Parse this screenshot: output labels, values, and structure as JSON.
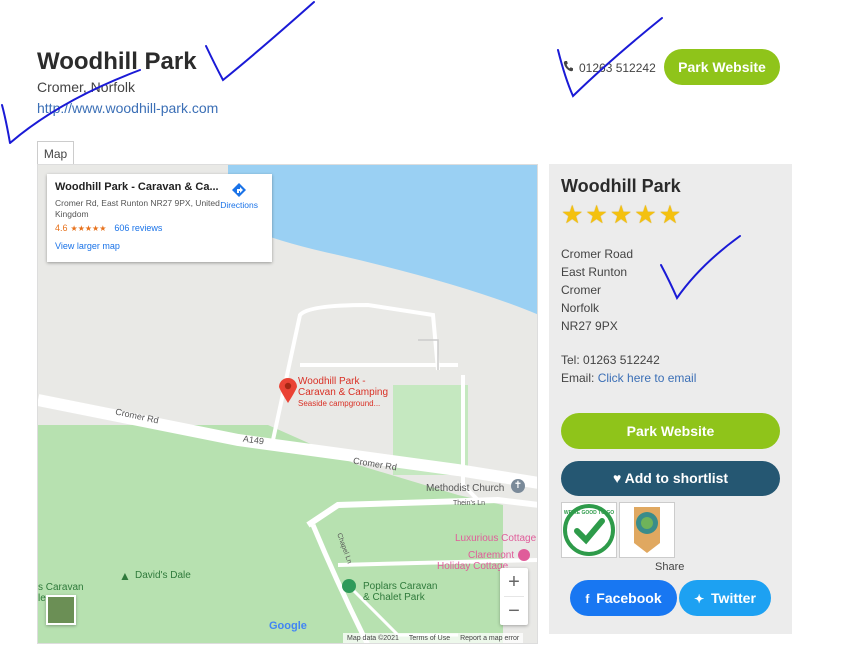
{
  "header": {
    "title": "Woodhill Park",
    "location": "Cromer, Norfolk",
    "website_url": "http://www.woodhill-park.com",
    "phone": "01263 512242",
    "website_button": "Park Website"
  },
  "tabs": [
    {
      "label": "Map",
      "active": true
    }
  ],
  "map": {
    "card": {
      "name": "Woodhill Park - Caravan & Ca...",
      "address": "Cromer Rd, East Runton NR27 9PX, United Kingdom",
      "rating": "4.6",
      "stars": "★★★★★",
      "reviews": "606 reviews",
      "directions": "Directions",
      "larger_map": "View larger map"
    },
    "labels": {
      "road1": "Cromer Rd",
      "road2": "A149",
      "road3": "Cromer Rd",
      "church": "Methodist Church",
      "theins": "Thein's Ln",
      "chapel": "Chapel Ln",
      "pin_title_1": "Woodhill Park -",
      "pin_title_2": "Caravan & Camping",
      "pin_sub": "Seaside campground...",
      "luxurious": "Luxurious Cottage",
      "claremont_1": "Claremont",
      "claremont_2": "Holiday Cottage",
      "davids_dale": "David's Dale",
      "poplars_1": "Poplars Caravan",
      "poplars_2": "& Chalet Park",
      "caravan_left_1": "s Caravan",
      "caravan_left_2": "le"
    },
    "zoom_in": "+",
    "zoom_out": "−",
    "google": "Google",
    "attribution": [
      "Map data ©2021",
      "Terms of Use",
      "Report a map error"
    ]
  },
  "sidebar": {
    "name": "Woodhill Park",
    "star_count": 5,
    "address_lines": [
      "Cromer Road",
      "East Runton",
      "Cromer",
      "Norfolk",
      "NR27 9PX"
    ],
    "tel_label": "Tel:",
    "tel": "01263 512242",
    "email_label": "Email:",
    "email_link": "Click here to email",
    "website_button": "Park Website",
    "shortlist_button": "Add to shortlist",
    "share_label": "Share",
    "facebook_button": "Facebook",
    "twitter_button": "Twitter",
    "badge_1_text": "WE'RE GOOD TO GO"
  },
  "colors": {
    "green": "#8fc41a",
    "navy": "#255772",
    "facebook": "#1877f2",
    "twitter": "#1da1f2",
    "star": "#f4c10f",
    "ink": "#1a1ad6"
  }
}
